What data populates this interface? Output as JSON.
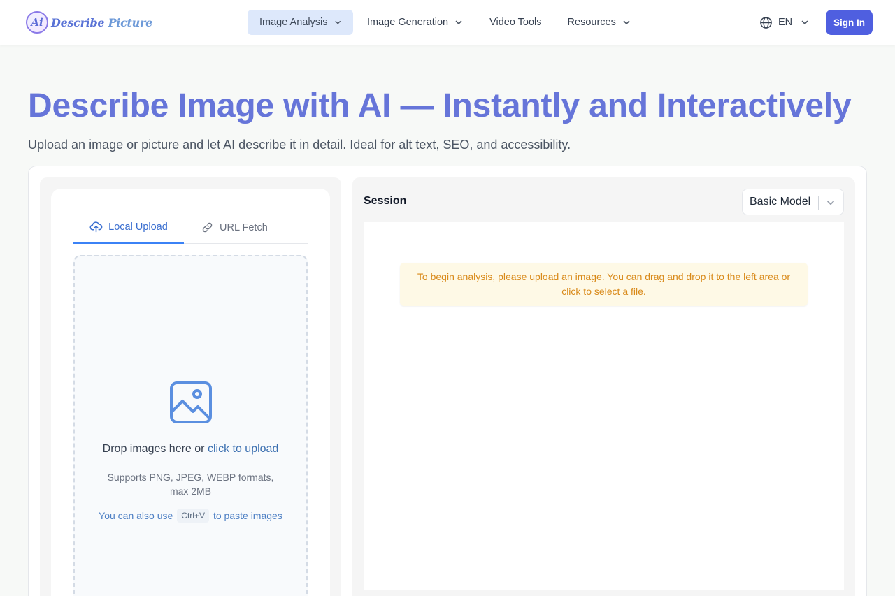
{
  "brand": {
    "logo_badge": "Ai",
    "name_part1": "Describe",
    "name_part2": "Picture"
  },
  "nav": {
    "items": [
      {
        "label": "Image Analysis",
        "has_dropdown": true,
        "active": true
      },
      {
        "label": "Image Generation",
        "has_dropdown": true,
        "active": false
      },
      {
        "label": "Video Tools",
        "has_dropdown": false,
        "active": false
      },
      {
        "label": "Resources",
        "has_dropdown": true,
        "active": false
      }
    ],
    "language": "EN",
    "signin_label": "Sign In"
  },
  "hero": {
    "title": "Describe Image with AI — Instantly and Interactively",
    "subtitle": "Upload an image or picture and let AI describe it in detail. Ideal for alt text, SEO, and accessibility."
  },
  "upload": {
    "tabs": [
      {
        "label": "Local Upload",
        "active": true,
        "icon": "cloud-upload-icon"
      },
      {
        "label": "URL Fetch",
        "active": false,
        "icon": "link-icon"
      }
    ],
    "drop_text": "Drop images here or",
    "drop_link": "click to upload",
    "supports": "Supports PNG, JPEG, WEBP formats, max 2MB",
    "paste_prefix": "You can also use",
    "paste_key": "Ctrl+V",
    "paste_suffix": "to paste images",
    "drop_icon": "image-icon"
  },
  "session": {
    "title": "Session",
    "model": "Basic Model",
    "notice": "To begin analysis, please upload an image. You can drag and drop it to the left area or click to select a file."
  },
  "colors": {
    "accent": "#4f5fe0",
    "hero_title": "#6675d9",
    "tab_active": "#3b6fd0",
    "notice_text": "#d98a1a",
    "notice_bg": "#fef9e6"
  }
}
